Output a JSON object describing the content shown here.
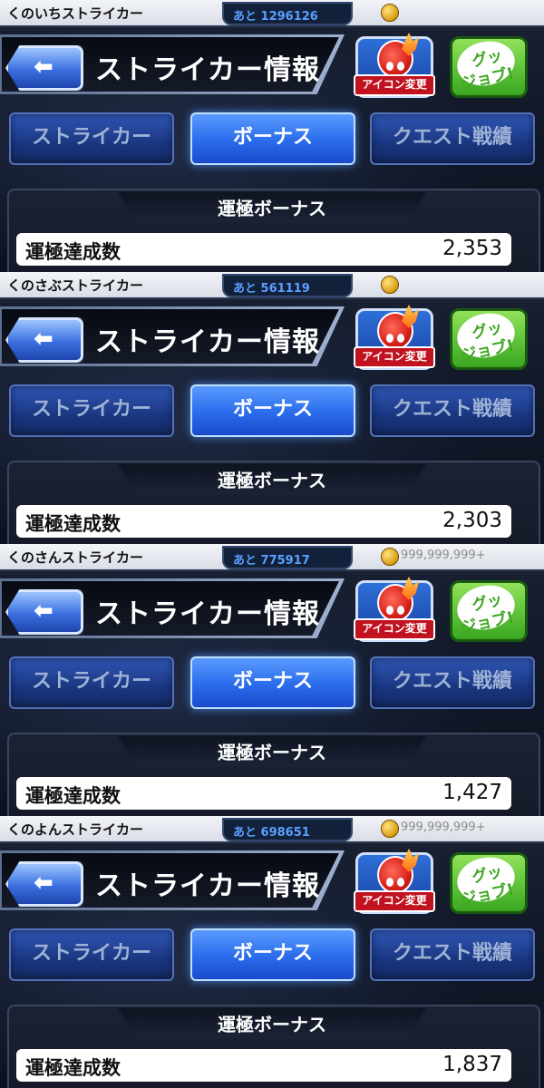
{
  "header": {
    "title": "ストライカー情報",
    "icon_change_label": "アイコン変更",
    "goodjob_line1": "グッ",
    "goodjob_line2": "ジョブ!"
  },
  "tabs": [
    "ストライカー",
    "ボーナス",
    "クエスト戦績"
  ],
  "active_tab": 1,
  "section_title": "運極ボーナス",
  "stat_label": "運極達成数",
  "panels": [
    {
      "player_name": "くのいちストライカー",
      "exp_text": "あと 1296126",
      "coins": "",
      "stat_value": "2,353"
    },
    {
      "player_name": "くのさぶストライカー",
      "exp_text": "あと 561119",
      "coins": "",
      "stat_value": "2,303"
    },
    {
      "player_name": "くのさんストライカー",
      "exp_text": "あと 775917",
      "coins": "999,999,999+",
      "stat_value": "1,427"
    },
    {
      "player_name": "くのよんストライカー",
      "exp_text": "あと 698651",
      "coins": "999,999,999+",
      "stat_value": "1,837"
    }
  ],
  "colors": {
    "tab_active": "#2a6bec",
    "tab_inactive": "#1a3680",
    "icon_change_red": "#c1121f",
    "goodjob_green": "#3aa61f"
  }
}
